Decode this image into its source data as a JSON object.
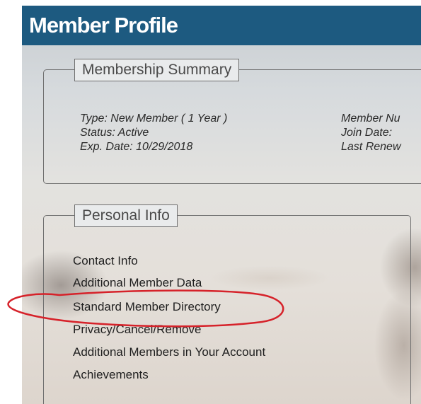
{
  "header": {
    "title": "Member Profile"
  },
  "membership_summary": {
    "legend": "Membership Summary",
    "left": [
      "Type: New Member ( 1 Year )",
      "Status: Active",
      "Exp. Date: 10/29/2018"
    ],
    "right": [
      "Member Nu",
      "Join Date:",
      "Last Renew"
    ]
  },
  "personal_info": {
    "legend": "Personal Info",
    "links": [
      "Contact Info",
      "Additional Member Data",
      "Standard Member Directory",
      "Privacy/Cancel/Remove",
      "Additional Members in Your Account",
      "Achievements"
    ]
  },
  "annotation": {
    "circled_item": "Standard Member Directory",
    "color": "#d6222a"
  },
  "colors": {
    "header_bg": "#1d5a80",
    "header_text": "#ffffff"
  }
}
